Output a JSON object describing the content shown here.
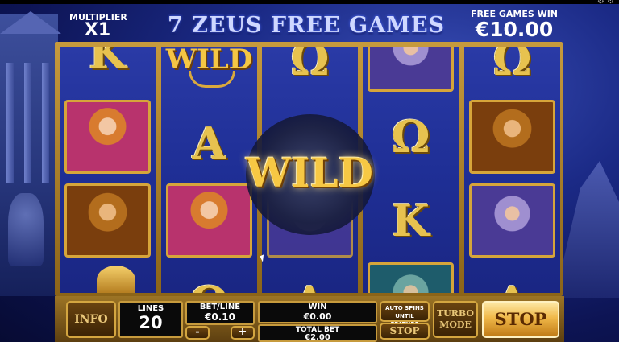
{
  "header": {
    "multiplier_label": "MULTIPLIER",
    "multiplier_value": "X1",
    "title": "7 ZEUS FREE GAMES",
    "free_games_win_label": "FREE GAMES WIN",
    "free_games_win_value": "€10.00"
  },
  "reels": [
    {
      "symbols": [
        "K",
        "portrait-woman",
        "portrait-warrior",
        "helmet"
      ]
    },
    {
      "symbols": [
        "WILD",
        "A",
        "portrait-woman",
        "Ω"
      ]
    },
    {
      "symbols": [
        "Ω",
        "WILD",
        "portrait-zeus-partial",
        "A"
      ]
    },
    {
      "symbols": [
        "portrait-zeus",
        "Ω",
        "K",
        "portrait-poseidon"
      ]
    },
    {
      "symbols": [
        "Ω",
        "portrait-warrior",
        "portrait-zeus",
        "A"
      ]
    }
  ],
  "overlay": {
    "big_wild_text": "WILD"
  },
  "symbols_text": {
    "K": "K",
    "A": "A",
    "omega": "Ω",
    "wild": "WILD"
  },
  "controls": {
    "info_label": "INFO",
    "lines_label": "LINES",
    "lines_value": "20",
    "bet_line_label": "BET/LINE",
    "bet_line_value": "€0.10",
    "minus_label": "-",
    "plus_label": "+",
    "win_label": "WIN",
    "win_value": "€0.00",
    "total_bet_label": "TOTAL BET",
    "total_bet_value": "€2.00",
    "auto_spins_label": "AUTO SPINS UNTIL FEATURE",
    "auto_stop_label": "STOP",
    "turbo_label": "TURBO MODE",
    "stop_label": "STOP"
  },
  "colors": {
    "gold": "#d4a640",
    "reel_blue": "#1f2f96",
    "background": "#0d1454"
  }
}
